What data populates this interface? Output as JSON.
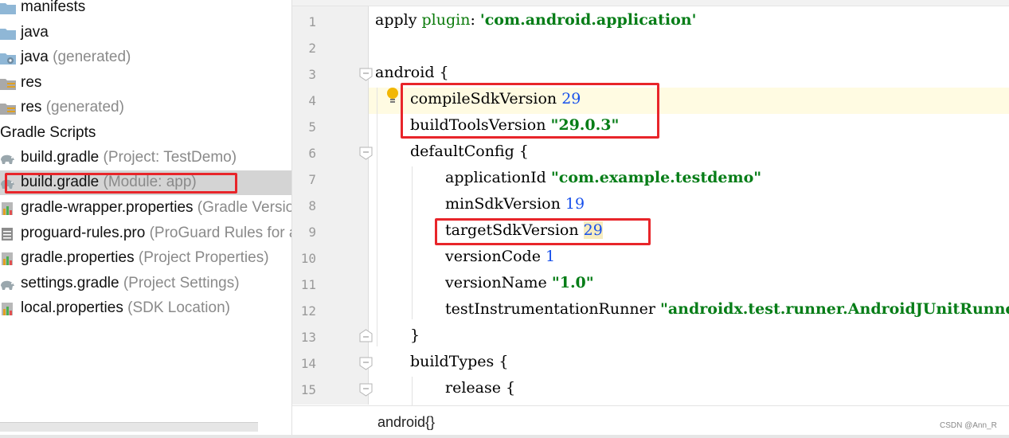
{
  "project_tree": {
    "items": [
      {
        "label": "manifests",
        "hint": "",
        "icon": "folder-icon"
      },
      {
        "label": "java",
        "hint": "",
        "icon": "folder-icon"
      },
      {
        "label": "java",
        "hint": "(generated)",
        "icon": "generated-folder-icon"
      },
      {
        "label": "res",
        "hint": "",
        "icon": "resource-folder-icon"
      },
      {
        "label": "res",
        "hint": "(generated)",
        "icon": "resource-folder-icon"
      },
      {
        "label": "Gradle Scripts",
        "hint": "",
        "icon": ""
      },
      {
        "label": "build.gradle",
        "hint": "(Project: TestDemo)",
        "icon": "gradle-elephant-icon"
      },
      {
        "label": "build.gradle",
        "hint": "(Module: app)",
        "icon": "gradle-elephant-icon"
      },
      {
        "label": "gradle-wrapper.properties",
        "hint": "(Gradle Version)",
        "icon": "properties-file-icon"
      },
      {
        "label": "proguard-rules.pro",
        "hint": "(ProGuard Rules for app)",
        "icon": "text-file-icon"
      },
      {
        "label": "gradle.properties",
        "hint": "(Project Properties)",
        "icon": "properties-file-icon"
      },
      {
        "label": "settings.gradle",
        "hint": "(Project Settings)",
        "icon": "gradle-elephant-icon"
      },
      {
        "label": "local.properties",
        "hint": "(SDK Location)",
        "icon": "properties-file-icon"
      }
    ]
  },
  "editor": {
    "line_numbers": [
      "1",
      "2",
      "3",
      "4",
      "5",
      "6",
      "7",
      "8",
      "9",
      "10",
      "11",
      "12",
      "13",
      "14",
      "15"
    ],
    "code": {
      "l1_kw": "apply ",
      "l1_plugin": "plugin",
      "l1_colon": ": ",
      "l1_str": "'com.android.application'",
      "l3": "android {",
      "l4_kw": "compileSdkVersion ",
      "l4_num": "29",
      "l5_kw": "buildToolsVersion ",
      "l5_str": "\"29.0.3\"",
      "l6": "defaultConfig {",
      "l7_kw": "applicationId ",
      "l7_str": "\"com.example.testdemo\"",
      "l8_kw": "minSdkVersion ",
      "l8_num": "19",
      "l9_kw": "targetSdkVersion ",
      "l9_num": "29",
      "l10_kw": "versionCode ",
      "l10_num": "1",
      "l11_kw": "versionName ",
      "l11_str": "\"1.0\"",
      "l12_kw": "testInstrumentationRunner ",
      "l12_str": "\"androidx.test.runner.AndroidJUnitRunner\"",
      "l13": "}",
      "l14": "buildTypes {",
      "l15": "release {"
    },
    "breadcrumb": "android{}"
  },
  "watermark": "CSDN @Ann_R",
  "colors": {
    "annotation_red": "#e8252a",
    "string_green": "#067d17",
    "number_blue": "#1750eb",
    "selection_gray": "#d4d4d4",
    "caret_row": "#fffbe2"
  }
}
